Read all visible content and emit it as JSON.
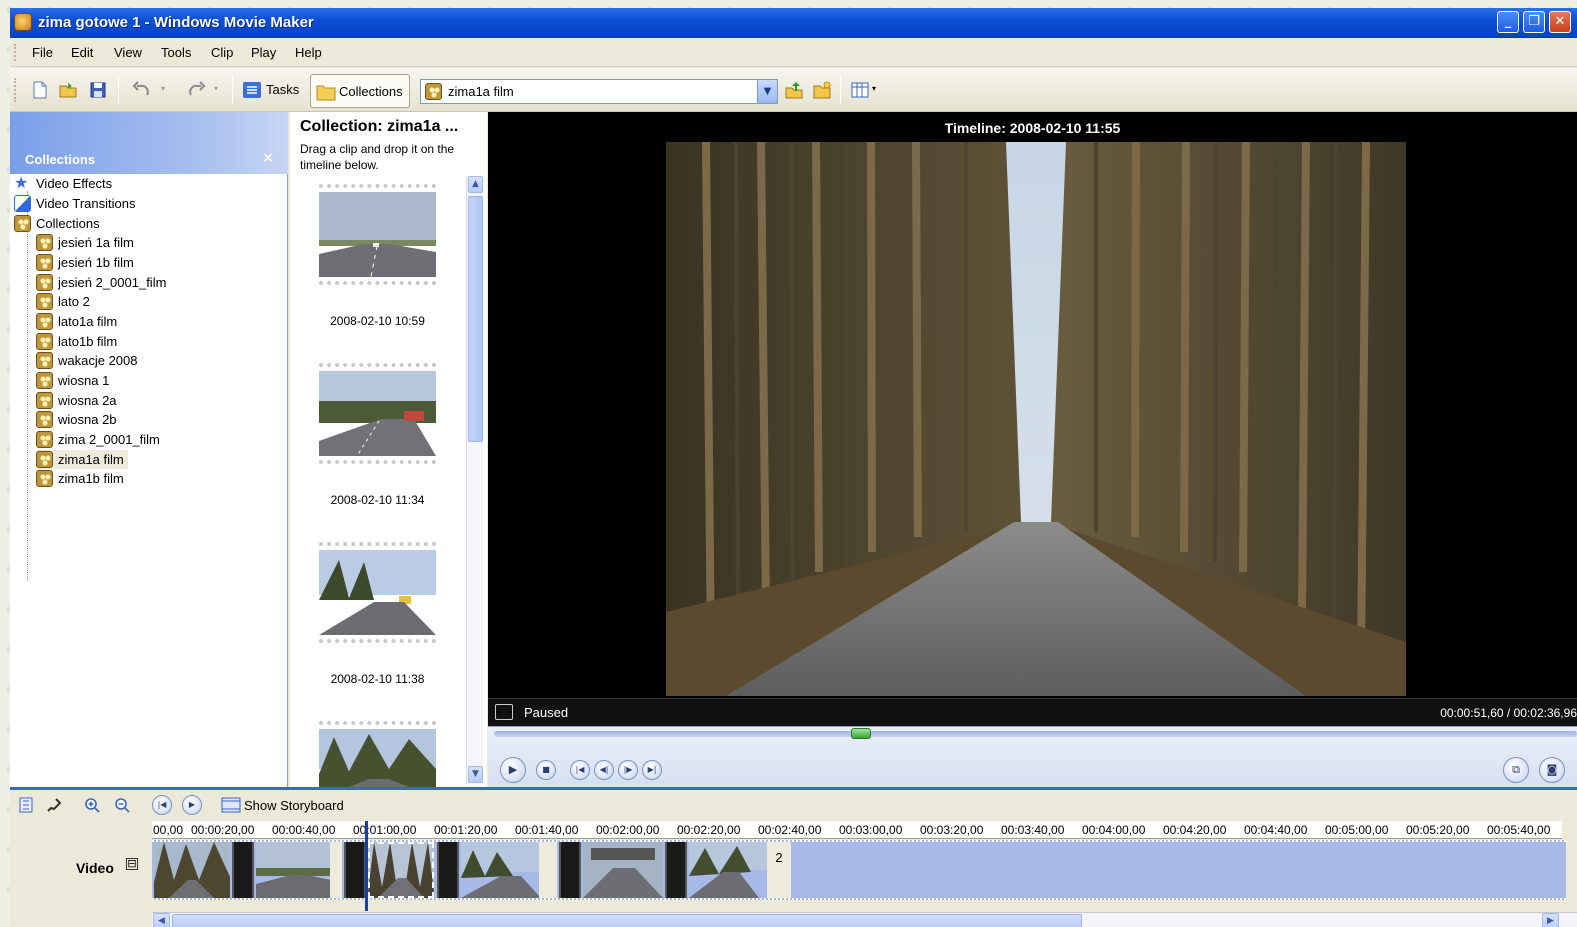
{
  "window": {
    "title": "zima gotowe 1 - Windows Movie Maker",
    "buttons": [
      "_",
      "❐",
      "✕"
    ]
  },
  "menu": [
    "File",
    "Edit",
    "View",
    "Tools",
    "Clip",
    "Play",
    "Help"
  ],
  "toolbar": {
    "tasks_label": "Tasks",
    "collections_label": "Collections",
    "address_value": "zima1a film"
  },
  "collections_panel": {
    "title": "Collections",
    "close": "×",
    "items": [
      {
        "label": "Video Effects",
        "icon": "star-icon"
      },
      {
        "label": "Video Transitions",
        "icon": "transition-icon"
      },
      {
        "label": "Collections",
        "icon": "film-reel-icon"
      },
      {
        "label": "jesień 1a film",
        "icon": "film-reel-icon"
      },
      {
        "label": "jesień 1b film",
        "icon": "film-reel-icon"
      },
      {
        "label": "jesień 2_0001_film",
        "icon": "film-reel-icon"
      },
      {
        "label": "lato 2",
        "icon": "film-reel-icon"
      },
      {
        "label": "lato1a film",
        "icon": "film-reel-icon"
      },
      {
        "label": "lato1b film",
        "icon": "film-reel-icon"
      },
      {
        "label": "wakacje 2008",
        "icon": "film-reel-icon"
      },
      {
        "label": "wiosna 1",
        "icon": "film-reel-icon"
      },
      {
        "label": "wiosna 2a",
        "icon": "film-reel-icon"
      },
      {
        "label": "wiosna 2b",
        "icon": "film-reel-icon"
      },
      {
        "label": "zima 2_0001_film",
        "icon": "film-reel-icon"
      },
      {
        "label": "zima1a film",
        "icon": "film-reel-icon",
        "selected": true
      },
      {
        "label": "zima1b film",
        "icon": "film-reel-icon"
      }
    ]
  },
  "collection_view": {
    "title": "Collection: zima1a ...",
    "subtitle": "Drag a clip and drop it on the timeline below.",
    "clips": [
      "2008-02-10 10:59",
      "2008-02-10 11:34",
      "2008-02-10 11:38"
    ]
  },
  "monitor": {
    "title": "Timeline: 2008-02-10 11:55",
    "status": "Paused",
    "time": "00:00:51,60 / 00:02:36,96",
    "seek_fraction": 0.33
  },
  "timeline": {
    "show_storyboard": "Show Storyboard",
    "track_label": "Video",
    "collapse": "⊟",
    "ruler": [
      "00,00",
      "00:00:20,00",
      "00:00:40,00",
      "00:01:00,00",
      "00:01:20,00",
      "00:01:40,00",
      "00:02:00,00",
      "00:02:20,00",
      "00:02:40,00",
      "00:03:00,00",
      "00:03:20,00",
      "00:03:40,00",
      "00:04:00,00",
      "00:04:20,00",
      "00:04:40,00",
      "00:05:00,00",
      "00:05:20,00",
      "00:05:40,00"
    ],
    "last_clip_label": "2"
  }
}
